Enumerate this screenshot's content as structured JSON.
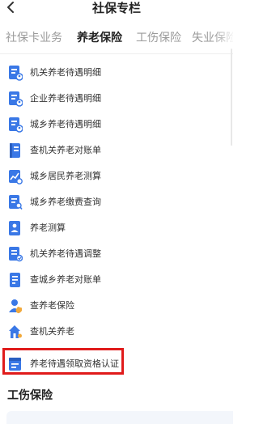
{
  "header": {
    "title": "社保专栏"
  },
  "tabs": [
    {
      "label": "社保卡业务"
    },
    {
      "label": "养老保险"
    },
    {
      "label": "工伤保险"
    },
    {
      "label": "失业保险"
    }
  ],
  "active_tab": "养老保险",
  "items": [
    {
      "label": "机关养老待遇明细",
      "icon": "document-person-icon"
    },
    {
      "label": "企业养老待遇明细",
      "icon": "document-person-icon"
    },
    {
      "label": "城乡养老待遇明细",
      "icon": "document-person-icon"
    },
    {
      "label": "查机关养老对账单",
      "icon": "passbook-icon"
    },
    {
      "label": "城乡居民养老测算",
      "icon": "calculator-chart-icon"
    },
    {
      "label": "城乡养老缴费查询",
      "icon": "document-search-icon"
    },
    {
      "label": "养老测算",
      "icon": "calculator-person-icon"
    },
    {
      "label": "机关养老待遇调整",
      "icon": "document-adjust-icon"
    },
    {
      "label": "查城乡养老对账单",
      "icon": "document-list-icon"
    },
    {
      "label": "查养老保险",
      "icon": "person-shield-icon"
    },
    {
      "label": "查机关养老",
      "icon": "building-person-icon"
    },
    {
      "label": "养老待遇领取资格认证",
      "icon": "id-verify-icon"
    }
  ],
  "next_section": {
    "title": "工伤保险"
  },
  "colors": {
    "accent": "#2f6fe8",
    "highlight": "#e01b1b",
    "icon": "#3a78e6"
  }
}
